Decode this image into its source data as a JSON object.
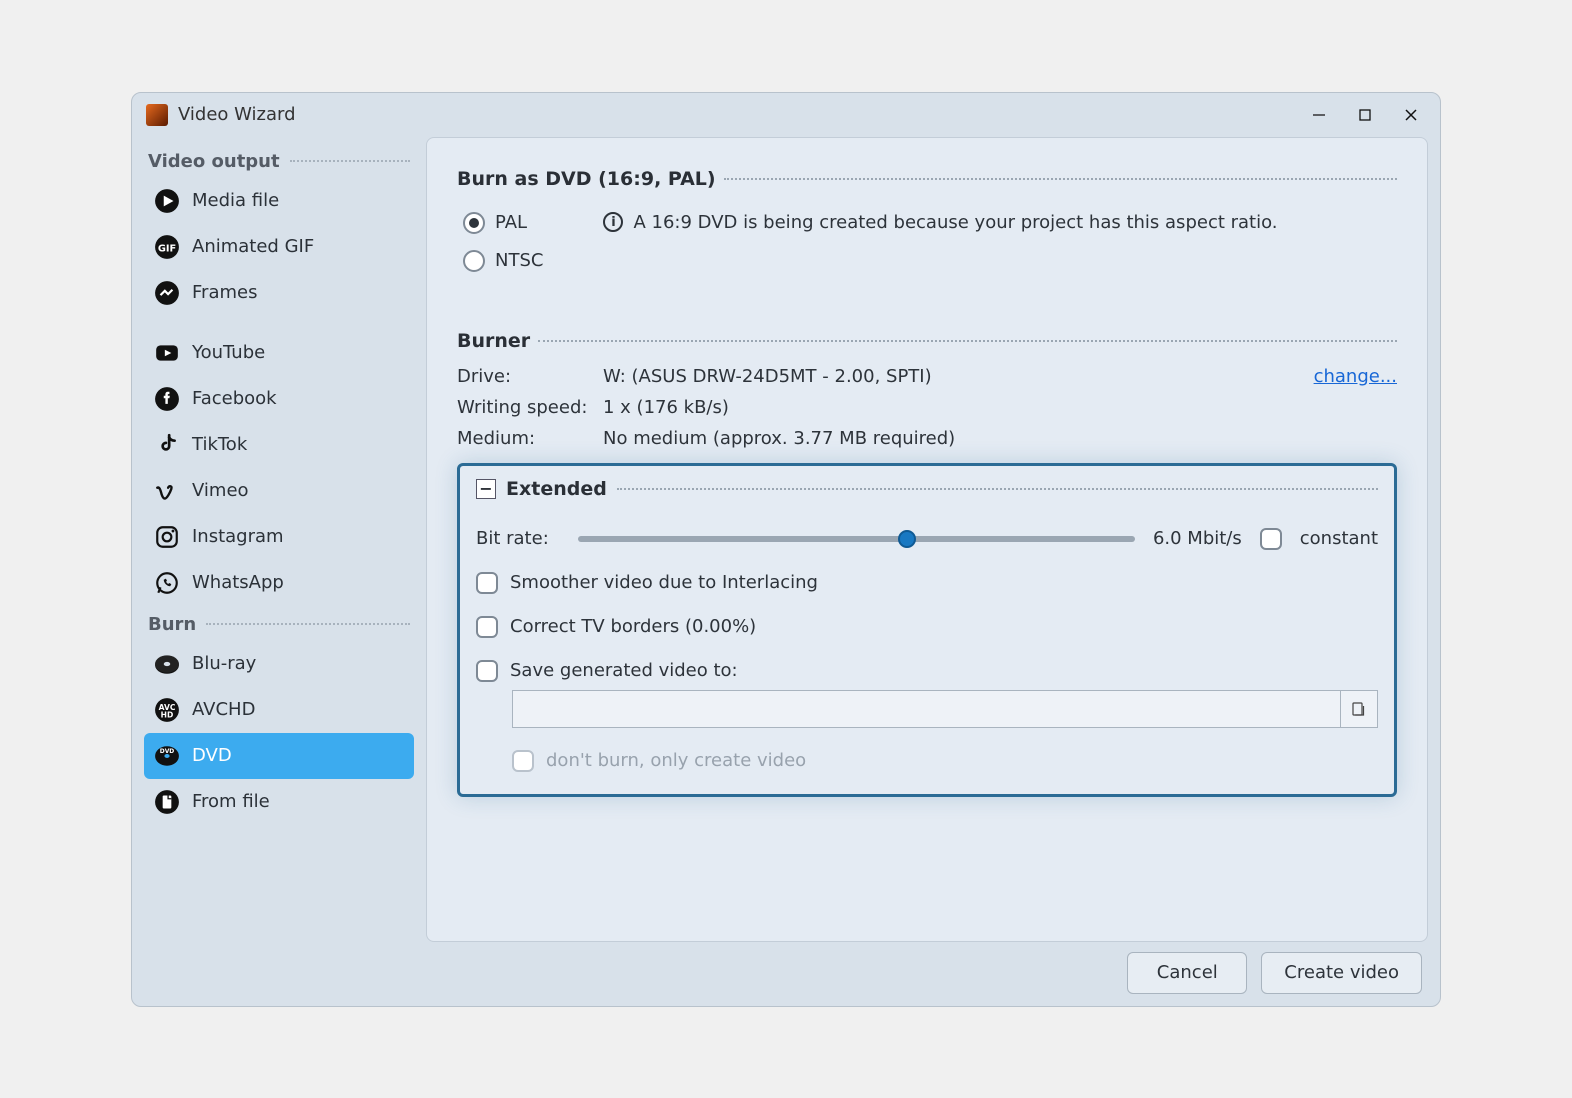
{
  "window": {
    "title": "Video Wizard"
  },
  "sidebar": {
    "group_output": "Video output",
    "group_burn": "Burn",
    "items_output": [
      {
        "label": "Media file"
      },
      {
        "label": "Animated GIF"
      },
      {
        "label": "Frames"
      },
      {
        "label": "YouTube"
      },
      {
        "label": "Facebook"
      },
      {
        "label": "TikTok"
      },
      {
        "label": "Vimeo"
      },
      {
        "label": "Instagram"
      },
      {
        "label": "WhatsApp"
      }
    ],
    "items_burn": [
      {
        "label": "Blu-ray"
      },
      {
        "label": "AVCHD"
      },
      {
        "label": "DVD"
      },
      {
        "label": "From file"
      }
    ]
  },
  "burnas": {
    "heading": "Burn as DVD (16:9, PAL)",
    "opt_pal": "PAL",
    "opt_ntsc": "NTSC",
    "info": "A 16:9 DVD is being created because your project has this aspect ratio."
  },
  "burner": {
    "heading": "Burner",
    "drive_label": "Drive:",
    "drive_value": "W: (ASUS DRW-24D5MT - 2.00, SPTI)",
    "change": "change...",
    "speed_label": "Writing speed:",
    "speed_value": "1 x (176 kB/s)",
    "medium_label": "Medium:",
    "medium_value": "No medium (approx. 3.77 MB required)"
  },
  "extended": {
    "heading": "Extended",
    "bitrate_label": "Bit rate:",
    "bitrate_value": "6.0 Mbit/s",
    "constant": "constant",
    "interlacing": "Smoother video due to Interlacing",
    "tvborders": "Correct TV borders (0.00%)",
    "saveto": "Save generated video to:",
    "noburn": "don't burn, only create video"
  },
  "footer": {
    "cancel": "Cancel",
    "create": "Create video"
  }
}
